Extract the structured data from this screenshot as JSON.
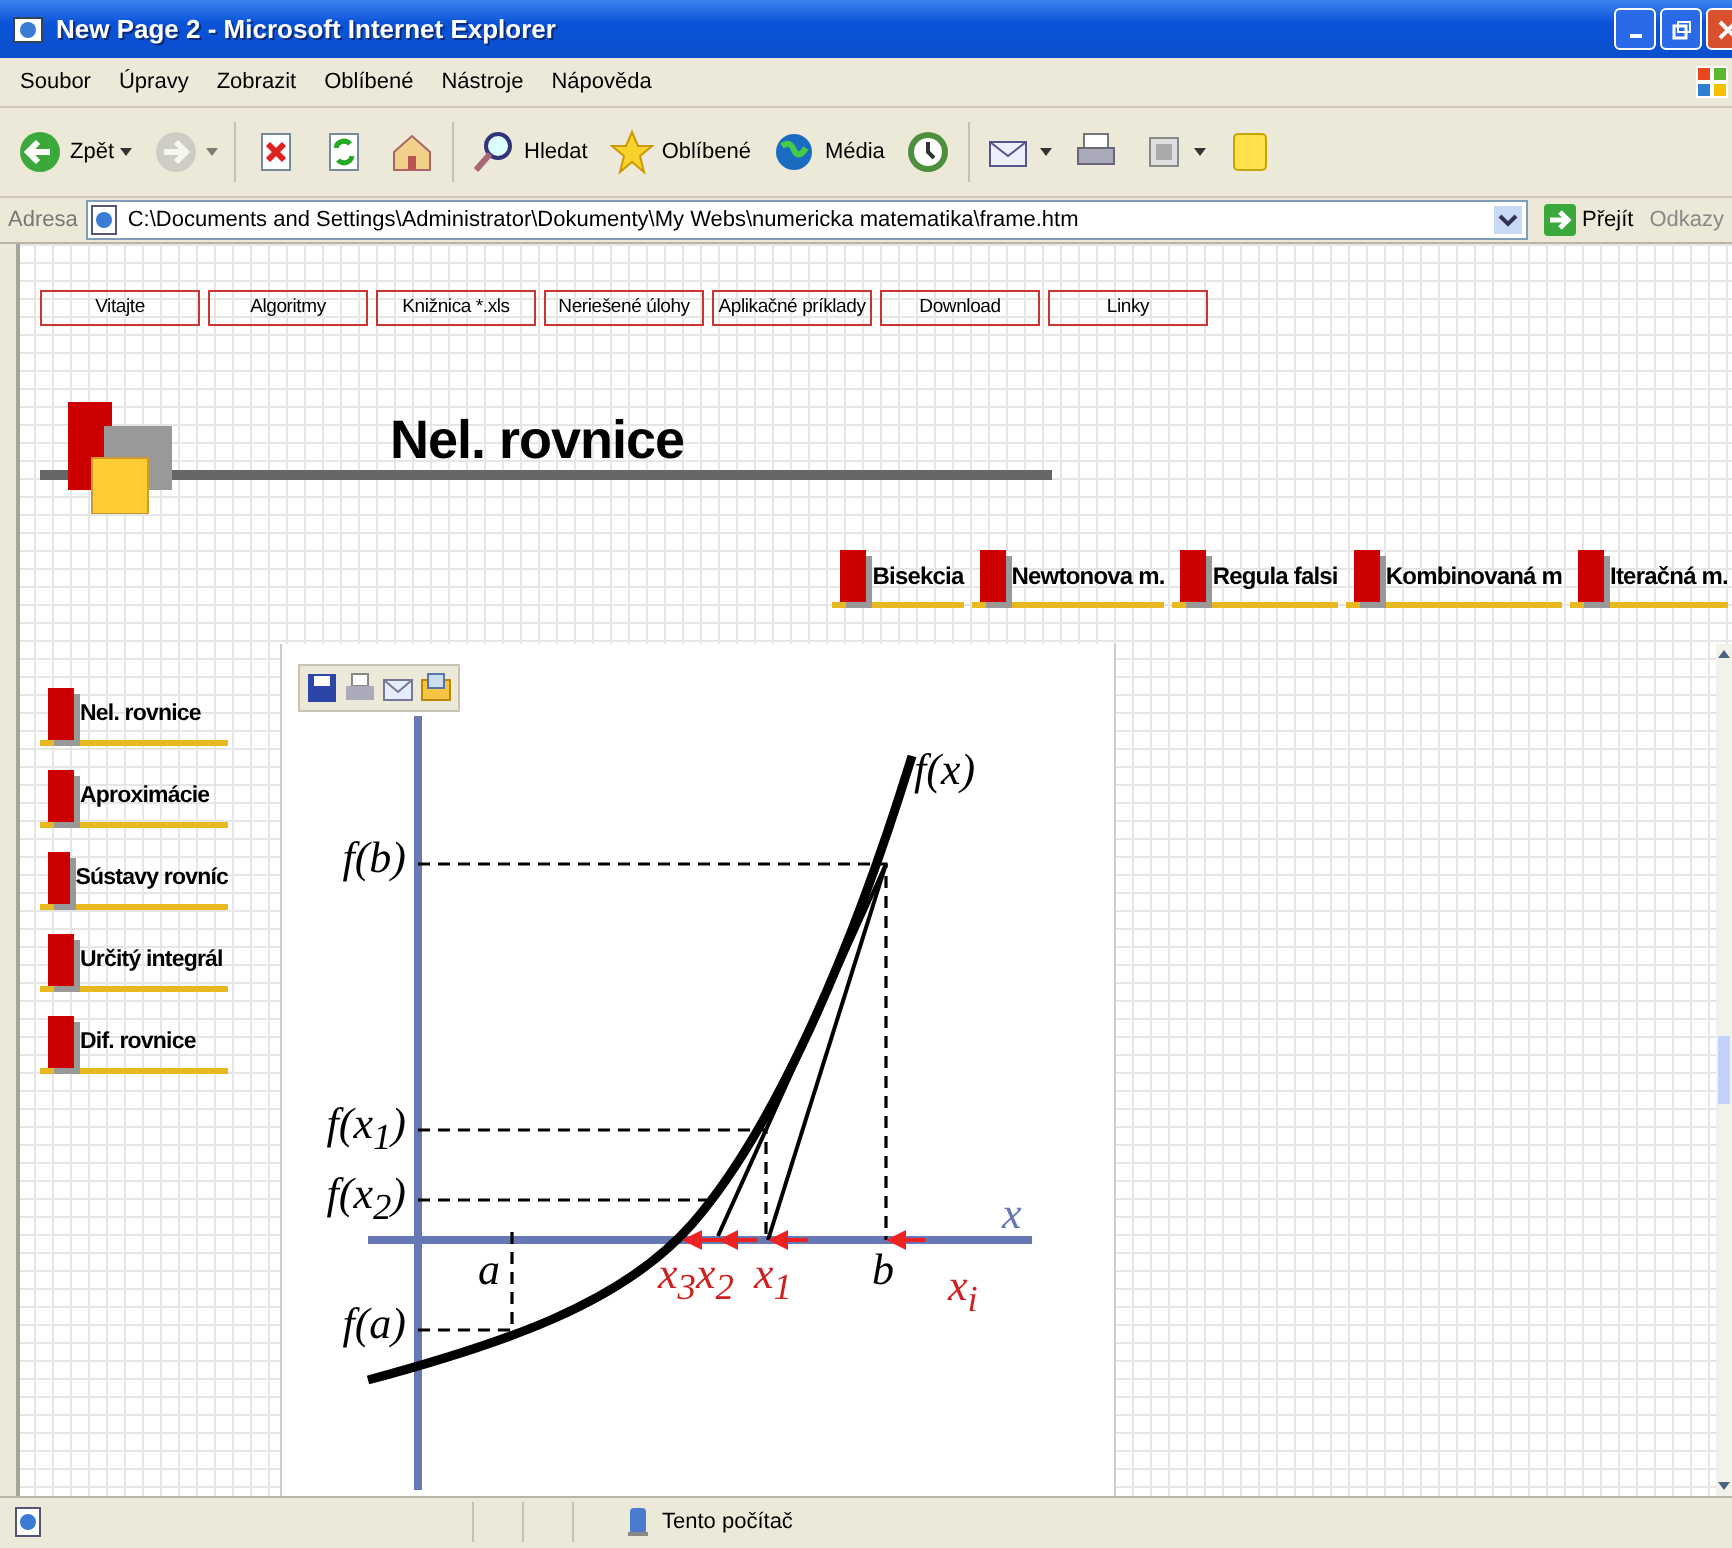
{
  "window": {
    "title": "New Page 2 - Microsoft Internet Explorer"
  },
  "menu": [
    "Soubor",
    "Úpravy",
    "Zobrazit",
    "Oblíbené",
    "Nástroje",
    "Nápověda"
  ],
  "toolbar": [
    {
      "kind": "back",
      "label": "Zpět",
      "disabled": false,
      "dropdown": true
    },
    {
      "kind": "forward",
      "disabled": true,
      "dropdown": true
    },
    {
      "kind": "stop",
      "disabled": false,
      "dropdown": false
    },
    {
      "kind": "refresh",
      "disabled": false,
      "dropdown": false
    },
    {
      "kind": "home",
      "disabled": false,
      "dropdown": false
    },
    {
      "kind": "search",
      "label": "Hledat",
      "disabled": false,
      "dropdown": false
    },
    {
      "kind": "favorites",
      "label": "Oblíbené",
      "disabled": false,
      "dropdown": false
    },
    {
      "kind": "media",
      "label": "Média",
      "disabled": false,
      "dropdown": false
    },
    {
      "kind": "history",
      "disabled": false,
      "dropdown": false
    },
    {
      "kind": "mail",
      "disabled": false,
      "dropdown": true
    },
    {
      "kind": "print",
      "disabled": false,
      "dropdown": false
    },
    {
      "kind": "edit",
      "disabled": false,
      "dropdown": true
    },
    {
      "kind": "note",
      "disabled": false,
      "dropdown": false
    }
  ],
  "address": {
    "label": "Adresa",
    "value": "C:\\Documents and Settings\\Administrator\\Dokumenty\\My Webs\\numericka matematika\\frame.htm",
    "go": "Přejít",
    "links": "Odkazy"
  },
  "top_nav": [
    "Vitajte",
    "Algoritmy",
    "Knižnica *.xls",
    "Neriešené úlohy",
    "Aplikačné príklady",
    "Download",
    "Linky"
  ],
  "page_title": "Nel. rovnice",
  "sub_nav": [
    "Bisekcia",
    "Newtonova m.",
    "Regula falsi",
    "Kombinovaná m",
    "Iteračná m."
  ],
  "side_nav": [
    "Nel. rovnice",
    "Aproximácie",
    "Sústavy rovníc",
    "Určitý integrál",
    "Dif. rovnice"
  ],
  "figure": {
    "curve_label": "f(x)",
    "axis_label": "x",
    "sequence_label": "x$_{i}$",
    "y_labels": [
      "f(b)",
      "f(x$_{1}$)",
      "f(x$_{2}$)",
      "f(a)"
    ],
    "x_labels": [
      {
        "text": "a",
        "color": "#000000"
      },
      {
        "text": "x$_{3}$",
        "color": "#cc2222"
      },
      {
        "text": "x$_{2}$",
        "color": "#cc2222"
      },
      {
        "text": "x$_{1}$",
        "color": "#cc2222"
      },
      {
        "text": "b",
        "color": "#000000"
      }
    ]
  },
  "status_bar": {
    "zone": "Tento počítač"
  }
}
